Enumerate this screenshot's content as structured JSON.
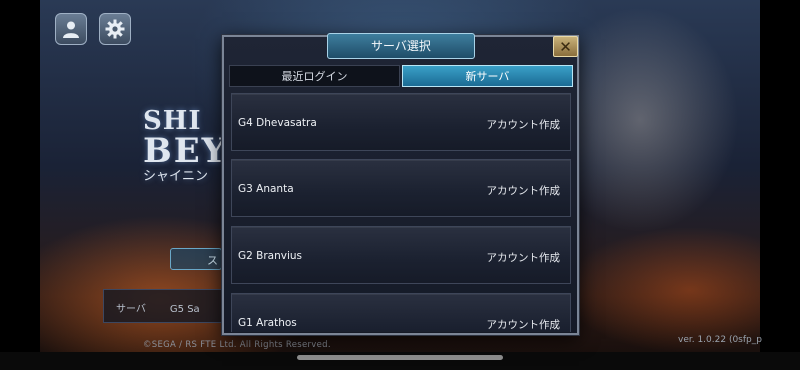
{
  "hud": {
    "account_icon": "person-icon",
    "settings_icon": "gear-icon"
  },
  "background": {
    "logo_line1": "SHI",
    "logo_line2": "BEY",
    "logo_line3": "シャイニン",
    "start_label": "ス",
    "server_label": "サーバ",
    "server_value": "G5 Sa",
    "copyright": "©SEGA / RS FTE Ltd. All Rights Reserved.",
    "version": "ver. 1.0.22 (0sfp_p"
  },
  "modal": {
    "title": "サーバ選択",
    "close_icon": "close-icon",
    "tabs": [
      {
        "label": "最近ログイン",
        "active": false
      },
      {
        "label": "新サーバ",
        "active": true
      }
    ],
    "servers": [
      {
        "name": "G4 Dhevasatra",
        "status": "アカウント作成"
      },
      {
        "name": "G3 Ananta",
        "status": "アカウント作成"
      },
      {
        "name": "G2 Branvius",
        "status": "アカウント作成"
      },
      {
        "name": "G1 Arathos",
        "status": "アカウント作成"
      }
    ]
  },
  "colors": {
    "active_tab": "#2a8bb4",
    "modal_bg": "#1a1f2d",
    "close_button": "#b39660"
  }
}
